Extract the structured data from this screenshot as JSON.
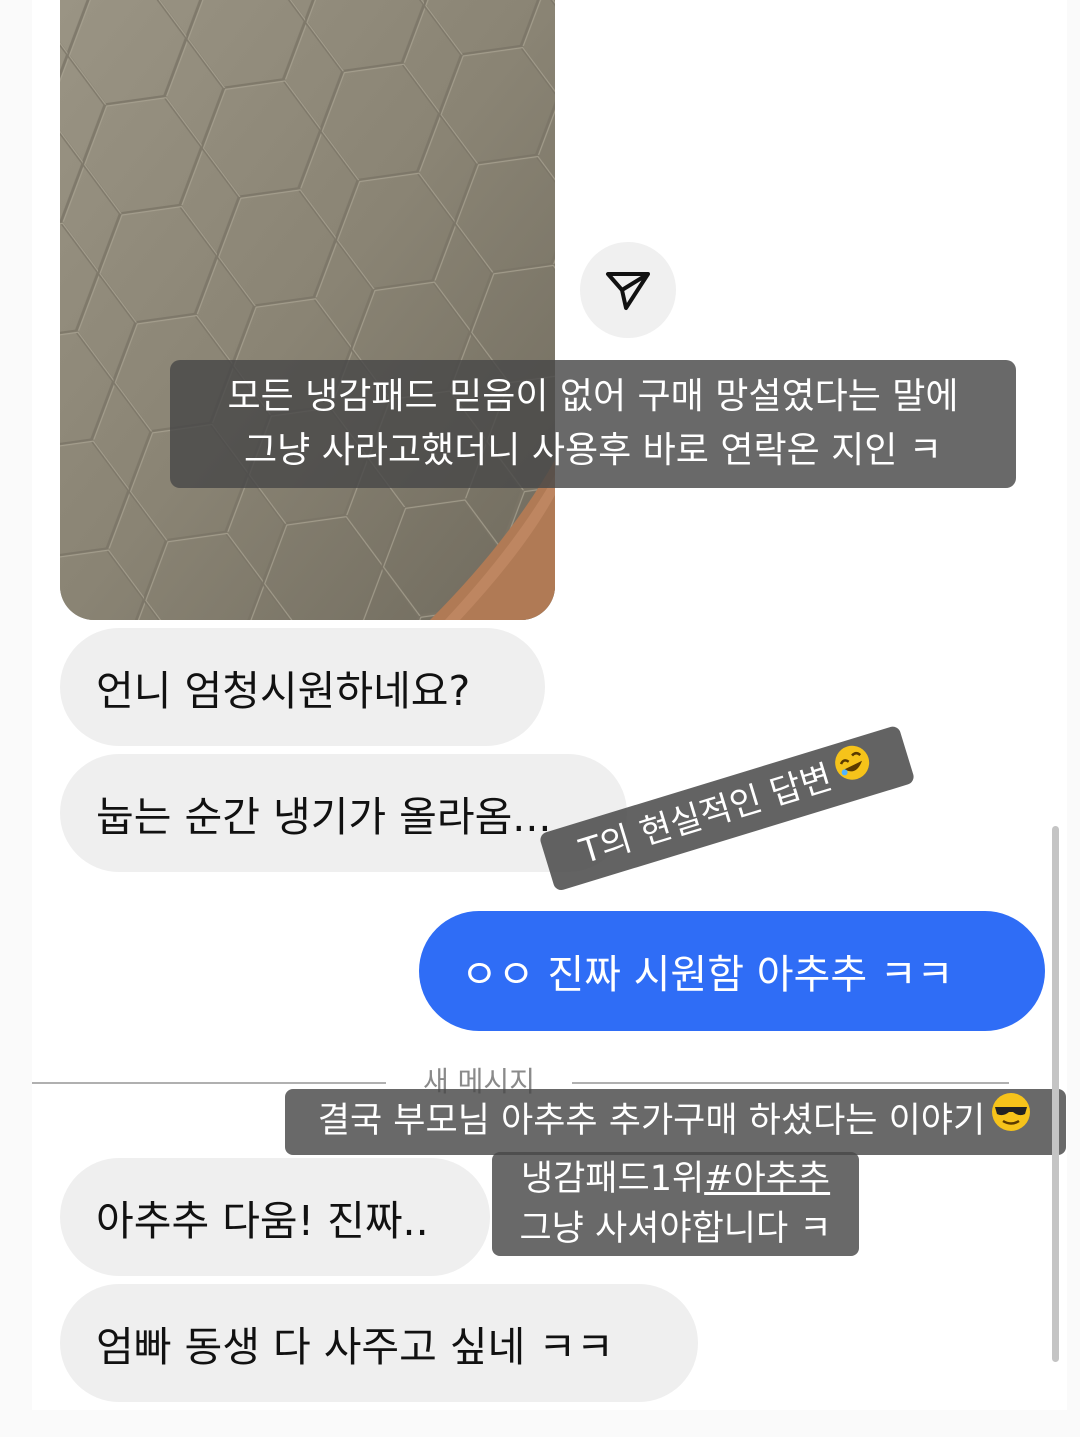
{
  "story_caption_top": {
    "line1": "모든 냉감패드 믿음이 없어 구매 망설였다는 말에",
    "line2": "그냥 사라고했더니 사용후 바로 연락온 지인 ㅋ"
  },
  "messages": [
    {
      "from": "other",
      "text": "언니 엄청시원하네요?"
    },
    {
      "from": "other",
      "text": "눕는 순간 냉기가 올라옴..."
    },
    {
      "from": "me",
      "text": "ㅇㅇ 진짜 시원함 아추추 ㅋㅋ"
    },
    {
      "from": "other",
      "text": "아추추 다움! 진짜.."
    },
    {
      "from": "other",
      "text": "엄빠 동생 다 사주고 싶네 ㅋㅋ"
    }
  ],
  "sticker_text": "T의 현실적인 답변",
  "sticker_emoji": "rolling-on-floor-laughing",
  "divider_label": "새 메시지",
  "story_caption_bottom": {
    "line1": "결국 부모님 아추추 추가구매 하셨다는 이야기",
    "line1_emoji": "sunglasses-face",
    "line2_prefix": "냉감패드1위",
    "line2_hashtag": "#아추추",
    "line3": "그냥 사셔야합니다 ㅋ"
  },
  "icons": {
    "share": "paper-plane-icon"
  },
  "colors": {
    "sent_bubble": "#2f6df6",
    "received_bubble": "#efefef",
    "overlay": "#484848"
  }
}
